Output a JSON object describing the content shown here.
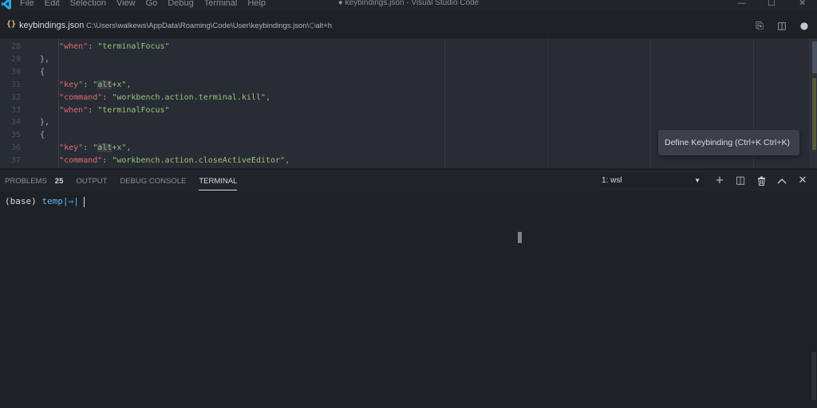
{
  "titlebar": {
    "menu": [
      "File",
      "Edit",
      "Selection",
      "View",
      "Go",
      "Debug",
      "Terminal",
      "Help"
    ],
    "window_title": "● keybindings.json - Visual Studio Code",
    "controls": {
      "minimize": "—",
      "maximize": "☐",
      "close": "✕"
    }
  },
  "tab": {
    "icon": "{}",
    "file_name": "keybindings.json",
    "path": "C:\\Users\\walkews\\AppData\\Roaming\\Code\\User\\keybindings.json\\",
    "symbol": "alt+h",
    "actions": {
      "open_preview": "⎘",
      "split": "◫",
      "dirty": "●"
    }
  },
  "editor": {
    "line_numbers": [
      "28",
      "29",
      "30",
      "31",
      "32",
      "33",
      "34",
      "35",
      "36",
      "37"
    ],
    "lines": [
      {
        "indent": "    ",
        "key": "\"when\"",
        "sep": ": ",
        "value": "\"terminalFocus\"",
        "end": ""
      },
      {
        "indent": "",
        "punc": "},"
      },
      {
        "indent": "",
        "punc": "{"
      },
      {
        "indent": "    ",
        "key": "\"key\"",
        "sep": ": ",
        "value_pre": "\"",
        "value_hl": "alt",
        "value_post": "+x\"",
        "end": ","
      },
      {
        "indent": "    ",
        "key": "\"command\"",
        "sep": ": ",
        "value": "\"workbench.action.terminal.kill\"",
        "end": ","
      },
      {
        "indent": "    ",
        "key": "\"when\"",
        "sep": ": ",
        "value": "\"terminalFocus\"",
        "end": ""
      },
      {
        "indent": "",
        "punc": "},"
      },
      {
        "indent": "",
        "punc": "{"
      },
      {
        "indent": "    ",
        "key": "\"key\"",
        "sep": ": ",
        "value_pre": "\"",
        "value_hl": "alt",
        "value_post": "+x\"",
        "end": ","
      },
      {
        "indent": "    ",
        "key": "\"command\"",
        "sep": ": ",
        "value": "\"workbench.action.closeActiveEditor\"",
        "end": ","
      }
    ],
    "tooltip": "Define Keybinding (Ctrl+K Ctrl+K)"
  },
  "panel": {
    "tabs": [
      {
        "label": "PROBLEMS",
        "badge": "25"
      },
      {
        "label": "OUTPUT"
      },
      {
        "label": "DEBUG CONSOLE"
      },
      {
        "label": "TERMINAL",
        "active": true
      }
    ],
    "terminal_select": "1: wsl",
    "actions": {
      "new": "+",
      "split": "◫",
      "kill": "🗑",
      "maximize": "^",
      "close": "✕"
    }
  },
  "terminal": {
    "prompt_env": "(base)",
    "prompt_dir": "temp",
    "prompt_symbol": "|⇒|"
  },
  "colors": {
    "key": "#e06c75",
    "string": "#98c379",
    "dir": "#61afef",
    "background": "#1e2227",
    "editor_background": "#282c34"
  }
}
